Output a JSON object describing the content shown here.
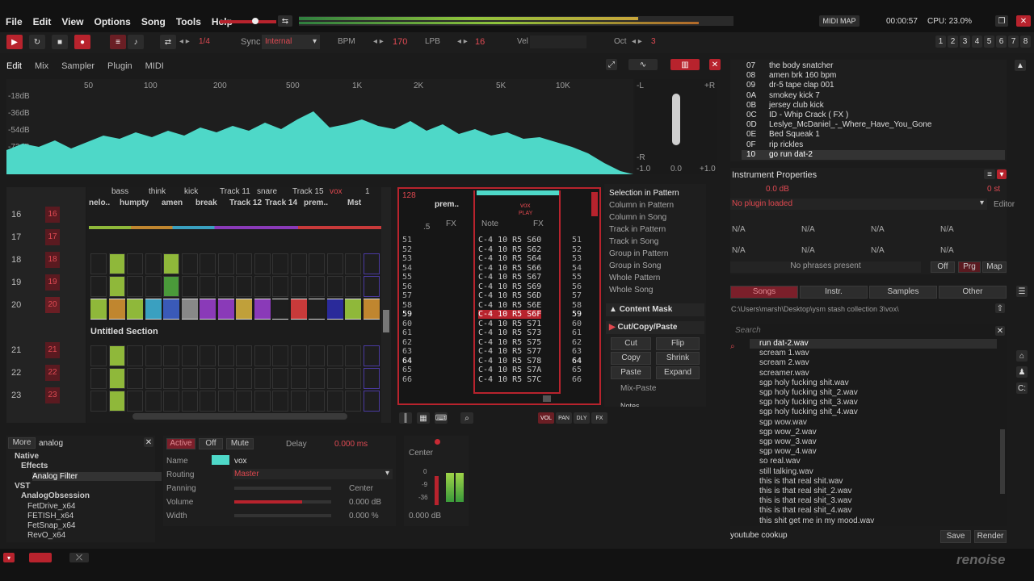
{
  "menu": [
    "File",
    "Edit",
    "View",
    "Options",
    "Song",
    "Tools",
    "Help"
  ],
  "topright": {
    "midimap": "MIDI MAP",
    "time": "00:00:57",
    "cpu": "CPU: 23.0%"
  },
  "toolbar": {
    "pattern_len": "1/4",
    "sync_label": "Sync",
    "sync_val": "Internal",
    "bpm_label": "BPM",
    "bpm": "170",
    "lpb_label": "LPB",
    "lpb": "16",
    "vel_label": "Vel",
    "oct_label": "Oct",
    "oct": "3",
    "tracks": [
      "1",
      "2",
      "3",
      "4",
      "5",
      "6",
      "7",
      "8"
    ]
  },
  "lowertabs": [
    "Edit",
    "Mix",
    "Sampler",
    "Plugin",
    "MIDI"
  ],
  "spectrum": {
    "freqs": [
      "50",
      "100",
      "200",
      "500",
      "1K",
      "2K",
      "5K",
      "10K"
    ],
    "db": [
      "-18dB",
      "-36dB",
      "-54dB",
      "-72dB"
    ],
    "scope_axis": [
      "-1.0",
      "0.0",
      "+1.0"
    ],
    "scope_lr": [
      "-L",
      "+R",
      "-R"
    ]
  },
  "tracks_top": [
    "bass",
    "think",
    "kick",
    "Track 11",
    "snare",
    "Track 15",
    "vox",
    "1"
  ],
  "tracks_top2": [
    "nelo..",
    "humpty",
    "amen",
    "break",
    "Track 12",
    "Track 14",
    "prem..",
    "Mst"
  ],
  "seqrows": [
    "16",
    "17",
    "18",
    "19",
    "20",
    "21",
    "22",
    "23"
  ],
  "section": "Untitled Section",
  "pattern": {
    "lines": "128",
    "name": "prem..",
    "num": ".5",
    "fx": "FX",
    "note": "Note",
    "rows": [
      "51",
      "52",
      "53",
      "54",
      "55",
      "56",
      "57",
      "58",
      "59",
      "60",
      "61",
      "62",
      "63",
      "64",
      "65",
      "66"
    ],
    "notes": [
      "C-4 10 R5 S60",
      "C-4 10 R5 S62",
      "C-4 10 R5 S64",
      "C-4 10 R5 S66",
      "C-4 10 R5 S67",
      "C-4 10 R5 S69",
      "C-4 10 R5 S6D",
      "C-4 10 R5 S6E",
      "C-4 10 R5 S6F",
      "C-4 10 R5 S71",
      "C-4 10 R5 S73",
      "C-4 10 R5 S75",
      "C-4 10 R5 S77",
      "C-4 10 R5 S78",
      "C-4 10 R5 S7A",
      "C-4 10 R5 S7C"
    ],
    "play": "PLAY"
  },
  "selection": [
    "Selection in Pattern",
    "Column in Pattern",
    "Column in Song",
    "Track in Pattern",
    "Track in Song",
    "Group in Pattern",
    "Group in Song",
    "Whole Pattern",
    "Whole Song"
  ],
  "contentmask": "Content Mask",
  "cutcopy": {
    "title": "Cut/Copy/Paste",
    "buttons": [
      "Cut",
      "Flip",
      "Copy",
      "Shrink",
      "Paste",
      "Expand"
    ],
    "mix": "Mix-Paste",
    "notes": "Notes"
  },
  "instruments": [
    [
      "07",
      "the body snatcher"
    ],
    [
      "08",
      "amen brk 160 bpm"
    ],
    [
      "09",
      "dr-5 tape clap 001"
    ],
    [
      "0A",
      "smokey kick 7"
    ],
    [
      "0B",
      "jersey club kick"
    ],
    [
      "0C",
      "ID - Whip Crack ( FX )"
    ],
    [
      "0D",
      "Leslye_McDaniel_-_Where_Have_You_Gone"
    ],
    [
      "0E",
      "Bed Squeak 1"
    ],
    [
      "0F",
      "rip rickles"
    ],
    [
      "10",
      "go run dat-2"
    ]
  ],
  "instprops": {
    "title": "Instrument Properties",
    "db": "0.0 dB",
    "st": "0 st",
    "plugin": "No plugin loaded",
    "editor": "Editor",
    "na": [
      "N/A",
      "N/A",
      "N/A",
      "N/A",
      "N/A",
      "N/A",
      "N/A",
      "N/A"
    ],
    "phrases": "No phrases present",
    "off": "Off",
    "prg": "Prg",
    "map": "Map"
  },
  "browser": {
    "tabs": [
      "Songs",
      "Instr.",
      "Samples",
      "Other"
    ],
    "path": "C:\\Users\\marsh\\Desktop\\ysm stash collection 3\\vox\\",
    "search": "Search",
    "files": [
      "run dat-2.wav",
      "scream 1.wav",
      "scream 2.wav",
      "screamer.wav",
      "sgp holy fucking shit.wav",
      "sgp holy fucking shit_2.wav",
      "sgp holy fucking shit_3.wav",
      "sgp holy fucking shit_4.wav",
      "sgp wow.wav",
      "sgp wow_2.wav",
      "sgp wow_3.wav",
      "sgp wow_4.wav",
      "so real.wav",
      "still talking.wav",
      "this is that real shit.wav",
      "this is that real shit_2.wav",
      "this is that real shit_3.wav",
      "this is that real shit_4.wav",
      "this shit get me in my mood.wav"
    ],
    "bottom": "youtube cookup",
    "save": "Save",
    "render": "Render"
  },
  "dsp": {
    "more": "More",
    "filter": "analog",
    "tree": [
      "Native",
      "Effects",
      "Analog Filter",
      "VST",
      "AnalogObsession",
      "FetDrive_x64",
      "FETISH_x64",
      "FetSnap_x64",
      "RevO_x64"
    ]
  },
  "trackprops": {
    "active": "Active",
    "off": "Off",
    "mute": "Mute",
    "delay": "Delay",
    "delay_val": "0.000 ms",
    "name_l": "Name",
    "name": "vox",
    "routing_l": "Routing",
    "routing": "Master",
    "pan_l": "Panning",
    "pan": "Center",
    "vol_l": "Volume",
    "vol": "0.000 dB",
    "width_l": "Width",
    "width": "0.000 %"
  },
  "meter": {
    "center": "Center",
    "scale": [
      "0",
      "-9",
      "-36"
    ],
    "db": "0.000 dB"
  },
  "logo": "renoise",
  "colors": {
    "accent": "#c82a34",
    "teal": "#4ed8c8",
    "bg": "#1b1b1b"
  }
}
